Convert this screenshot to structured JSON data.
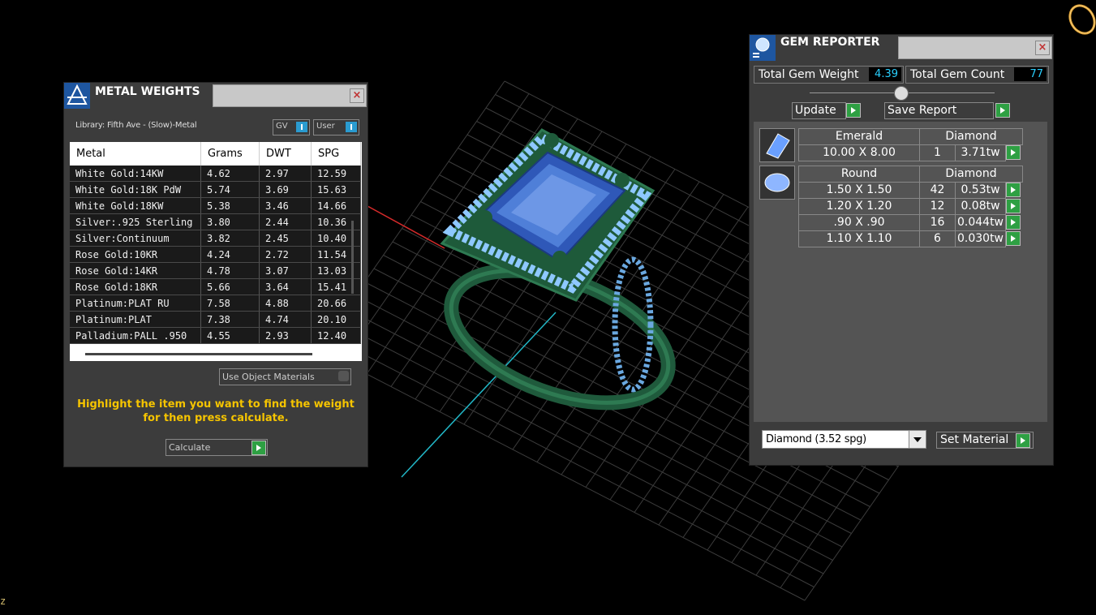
{
  "viewport": {
    "axis_label": "z"
  },
  "metal_panel": {
    "title": "METAL WEIGHTS",
    "library_label": "Library: Fifth Ave - (Slow)-Metal",
    "toggle_gv": "GV",
    "toggle_user": "User",
    "columns": [
      "Metal",
      "Grams",
      "DWT",
      "SPG"
    ],
    "rows": [
      [
        "White Gold:14KW",
        "4.62",
        "2.97",
        "12.59"
      ],
      [
        "White Gold:18K PdW",
        "5.74",
        "3.69",
        "15.63"
      ],
      [
        "White Gold:18KW",
        "5.38",
        "3.46",
        "14.66"
      ],
      [
        "Silver:.925 Sterling",
        "3.80",
        "2.44",
        "10.36"
      ],
      [
        "Silver:Continuum",
        "3.82",
        "2.45",
        "10.40"
      ],
      [
        "Rose Gold:10KR",
        "4.24",
        "2.72",
        "11.54"
      ],
      [
        "Rose Gold:14KR",
        "4.78",
        "3.07",
        "13.03"
      ],
      [
        "Rose Gold:18KR",
        "5.66",
        "3.64",
        "15.41"
      ],
      [
        "Platinum:PLAT RU",
        "7.58",
        "4.88",
        "20.66"
      ],
      [
        "Platinum:PLAT",
        "7.38",
        "4.74",
        "20.10"
      ],
      [
        "Palladium:PALL .950",
        "4.55",
        "2.93",
        "12.40"
      ]
    ],
    "use_object_materials": "Use Object Materials",
    "hint_line1": "Highlight the item you want to find the weight",
    "hint_line2": "for then press calculate.",
    "calculate_label": "Calculate"
  },
  "gem_panel": {
    "title": "GEM REPORTER",
    "total_weight_label": "Total Gem Weight",
    "total_weight_value": "4.39",
    "total_count_label": "Total Gem Count",
    "total_count_value": "77",
    "update_label": "Update",
    "save_report_label": "Save Report",
    "groups": [
      {
        "icon": "emerald-cut-gem-icon",
        "shape": "Emerald",
        "material": "Diamond",
        "rows": [
          {
            "size": "10.00 X 8.00",
            "count": "1",
            "weight": "3.71tw"
          }
        ]
      },
      {
        "icon": "round-gem-icon",
        "shape": "Round",
        "material": "Diamond",
        "rows": [
          {
            "size": "1.50 X 1.50",
            "count": "42",
            "weight": "0.53tw"
          },
          {
            "size": "1.20 X 1.20",
            "count": "12",
            "weight": "0.08tw"
          },
          {
            "size": ".90 X .90",
            "count": "16",
            "weight": "0.044tw"
          },
          {
            "size": "1.10 X 1.10",
            "count": "6",
            "weight": "0.030tw"
          }
        ]
      }
    ],
    "material_select": "Diamond    (3.52 spg)",
    "set_material_label": "Set Material"
  },
  "colors": {
    "play_button": "#2ea043",
    "hint_text": "#f5c400",
    "value_text": "#2ad0ff",
    "grid": "#3a3a3a",
    "ring_metal": "#1f5a3c",
    "gem_blue": "#4f7fd8",
    "accent_diamond": "#8ec8ff"
  }
}
